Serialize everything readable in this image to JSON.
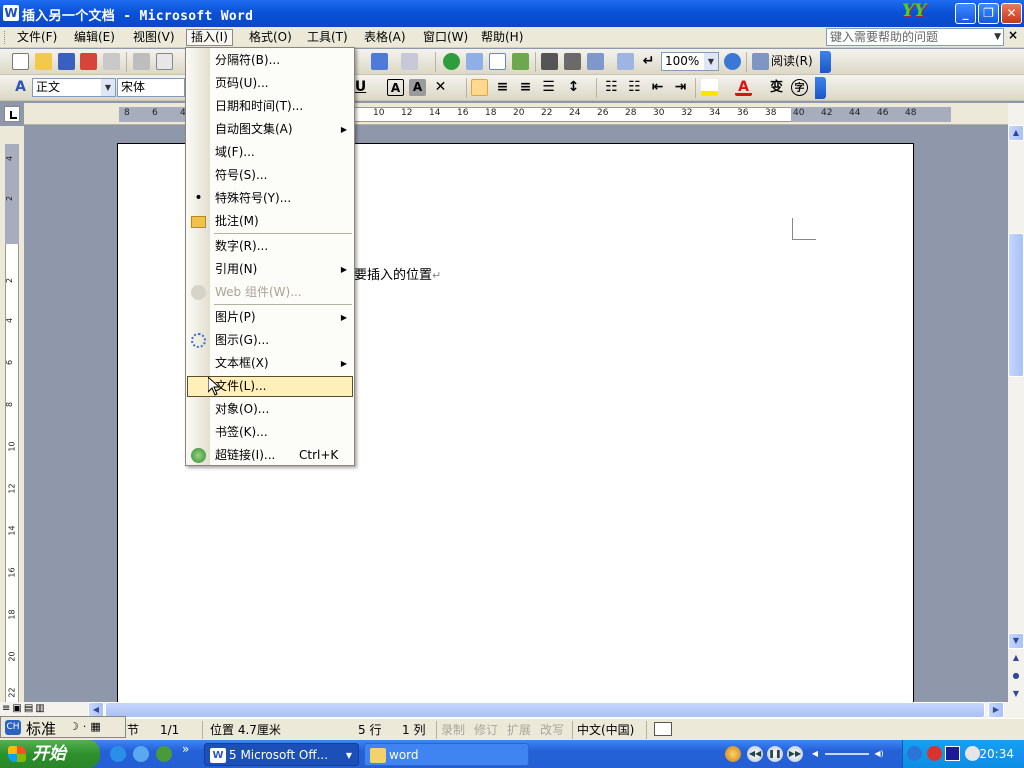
{
  "window": {
    "title": "插入另一个文档 - Microsoft Word",
    "app_icon": "W",
    "logo_text": "YY",
    "minimize": "_",
    "maximize": "❐",
    "close": "✕"
  },
  "menubar": {
    "items": [
      {
        "label": "文件(F)"
      },
      {
        "label": "编辑(E)"
      },
      {
        "label": "视图(V)"
      },
      {
        "label": "插入(I)"
      },
      {
        "label": "格式(O)"
      },
      {
        "label": "工具(T)"
      },
      {
        "label": "表格(A)"
      },
      {
        "label": "窗口(W)"
      },
      {
        "label": "帮助(H)"
      }
    ],
    "active": "插入(I)",
    "help_placeholder": "键入需要帮助的问题",
    "close_doc": "×"
  },
  "toolbar": {
    "zoom": "100%",
    "read_label": "阅读(R)",
    "style": "正文",
    "font": "宋体",
    "underline": "U",
    "box_a": "A",
    "shade_a": "A",
    "font_color": "A",
    "phonetic": "变",
    "enclose": "字"
  },
  "ruler": {
    "numbers": [
      "8",
      "6",
      "4",
      "10",
      "12",
      "14",
      "16",
      "18",
      "20",
      "22",
      "24",
      "26",
      "28",
      "30",
      "32",
      "34",
      "36",
      "38",
      "40",
      "42",
      "44",
      "46",
      "48"
    ],
    "vnumbers": [
      "4",
      "2",
      "2",
      "4",
      "6",
      "8",
      "10",
      "12",
      "14",
      "16",
      "18",
      "20",
      "22"
    ]
  },
  "document": {
    "body_text": "要插入的位置",
    "para_mark": "↵"
  },
  "insert_menu": {
    "items": [
      {
        "label": "分隔符(B)...",
        "icon": "none"
      },
      {
        "label": "页码(U)...",
        "icon": "none"
      },
      {
        "label": "日期和时间(T)...",
        "icon": "none"
      },
      {
        "label": "自动图文集(A)",
        "icon": "none",
        "submenu": true
      },
      {
        "label": "域(F)...",
        "icon": "none"
      },
      {
        "label": "符号(S)...",
        "icon": "none"
      },
      {
        "label": "特殊符号(Y)...",
        "icon": "bullet-icon"
      },
      {
        "label": "批注(M)",
        "icon": "comment-folder-icon"
      },
      {
        "label": "数字(R)...",
        "icon": "none"
      },
      {
        "label": "引用(N)",
        "icon": "none",
        "submenu": true
      },
      {
        "label": "Web 组件(W)...",
        "icon": "web-component-icon",
        "disabled": true
      },
      {
        "label": "图片(P)",
        "icon": "none",
        "submenu": true
      },
      {
        "label": "图示(G)...",
        "icon": "diagram-icon"
      },
      {
        "label": "文本框(X)",
        "icon": "none",
        "submenu": true
      },
      {
        "label": "文件(L)...",
        "icon": "none",
        "hover": true
      },
      {
        "label": "对象(O)...",
        "icon": "none"
      },
      {
        "label": "书签(K)...",
        "icon": "none"
      },
      {
        "label": "超链接(I)...",
        "icon": "hyperlink-globe-icon",
        "shortcut": "Ctrl+K"
      }
    ]
  },
  "statusbar": {
    "section": "节",
    "pages": "1/1",
    "position": "位置 4.7厘米",
    "line": "5 行",
    "column": "1 列",
    "rec": "录制",
    "trk": "修订",
    "ext": "扩展",
    "ovr": "改写",
    "language": "中文(中国)"
  },
  "ime": {
    "mode": "标准",
    "logo": "CH"
  },
  "taskbar": {
    "start": "开始",
    "tasks": [
      {
        "label": "5 Microsoft Off...",
        "icon": "word-icon"
      },
      {
        "label": "word",
        "icon": "folder-icon"
      }
    ],
    "clock": "20:34",
    "more": "»"
  },
  "colors": {
    "title_blue": "#0b52d8",
    "menu_bg": "#ece9d8",
    "hover_item": "#ffefbb",
    "doc_bg": "#8f97ab",
    "taskbar_blue": "#245fd4",
    "start_green": "#2f8f2d"
  }
}
